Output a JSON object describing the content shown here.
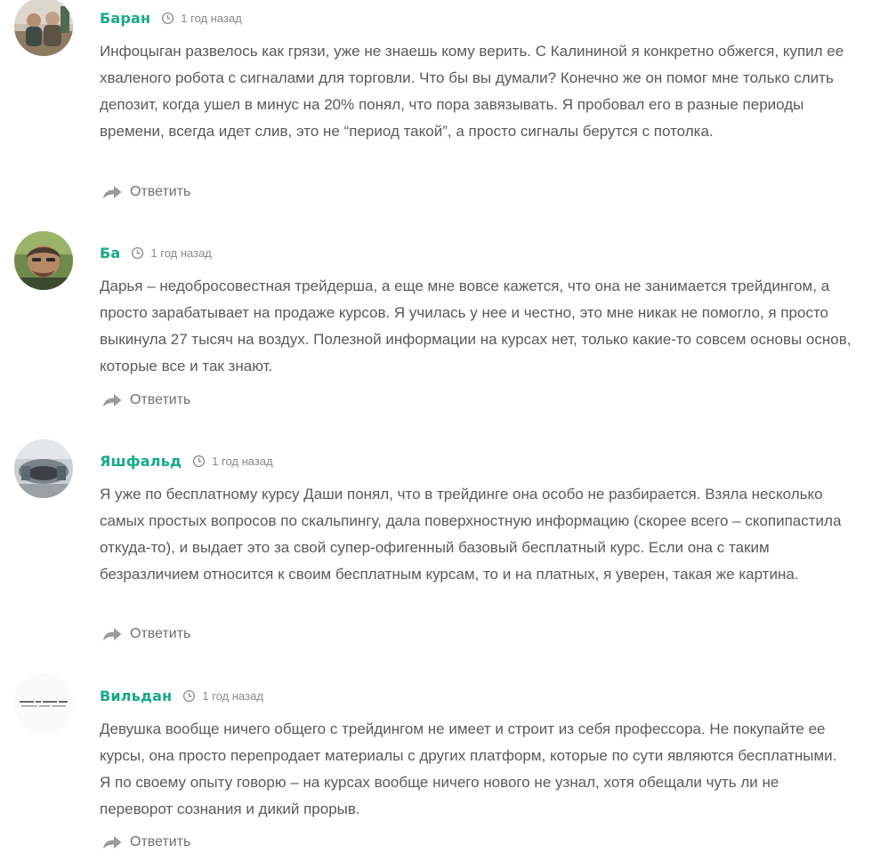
{
  "comments": [
    {
      "author": "Баран",
      "time": "1 год назад",
      "text": "Инфоцыган развелось как грязи, уже не знаешь кому верить. С Калининой я конкретно обжегся, купил ее хваленого робота с сигналами для торговли. Что бы вы думали? Конечно же он помог мне только слить депозит, когда ушел в минус на 20% понял, что пора завязывать. Я пробовал его в разные периоды времени, всегда идет слив, это не “период такой”, а просто сигналы берутся с потолка.",
      "reply_label": "Ответить"
    },
    {
      "author": "Ба",
      "time": "1 год назад",
      "text": "Дарья – недобросовестная трейдерша, а еще мне вовсе кажется, что она не занимается трейдингом, а просто зарабатывает на продаже курсов. Я училась у нее и честно, это мне никак не помогло, я просто выкинула 27 тысяч на воздух. Полезной информации на курсах нет, только какие-то совсем основы основ, которые все и так знают.",
      "reply_label": "Ответить"
    },
    {
      "author": "Яшфальд",
      "time": "1 год назад",
      "text": "Я уже по бесплатному курсу Даши понял, что в трейдинге она особо не разбирается. Взяла несколько самых простых вопросов по скальпингу, дала поверхностную информацию (скорее всего – скопипастила откуда-то), и выдает это за свой супер-офигенный базовый бесплатный курс. Если она с таким безразличием относится к своим бесплатным курсам, то и на платных, я уверен, такая же картина.",
      "reply_label": "Ответить"
    },
    {
      "author": "Вильдан",
      "time": "1 год назад",
      "text": "Девушка вообще ничего общего с трейдингом не имеет и строит из себя профессора. Не покупайте ее курсы, она просто перепродает материалы с других платформ, которые по сути являются бесплатными. Я по своему опыту говорю – на курсах вообще ничего нового не узнал, хотя обещали чуть ли не переворот сознания и дикий прорыв.",
      "reply_label": "Ответить"
    }
  ],
  "colors": {
    "author": "#16a98a",
    "text": "#5a5a5a",
    "meta": "#8a8a8a",
    "reply_icon": "#9a9a9a"
  },
  "icons": {
    "time": "clock-icon",
    "reply": "reply-arrow-icon"
  }
}
